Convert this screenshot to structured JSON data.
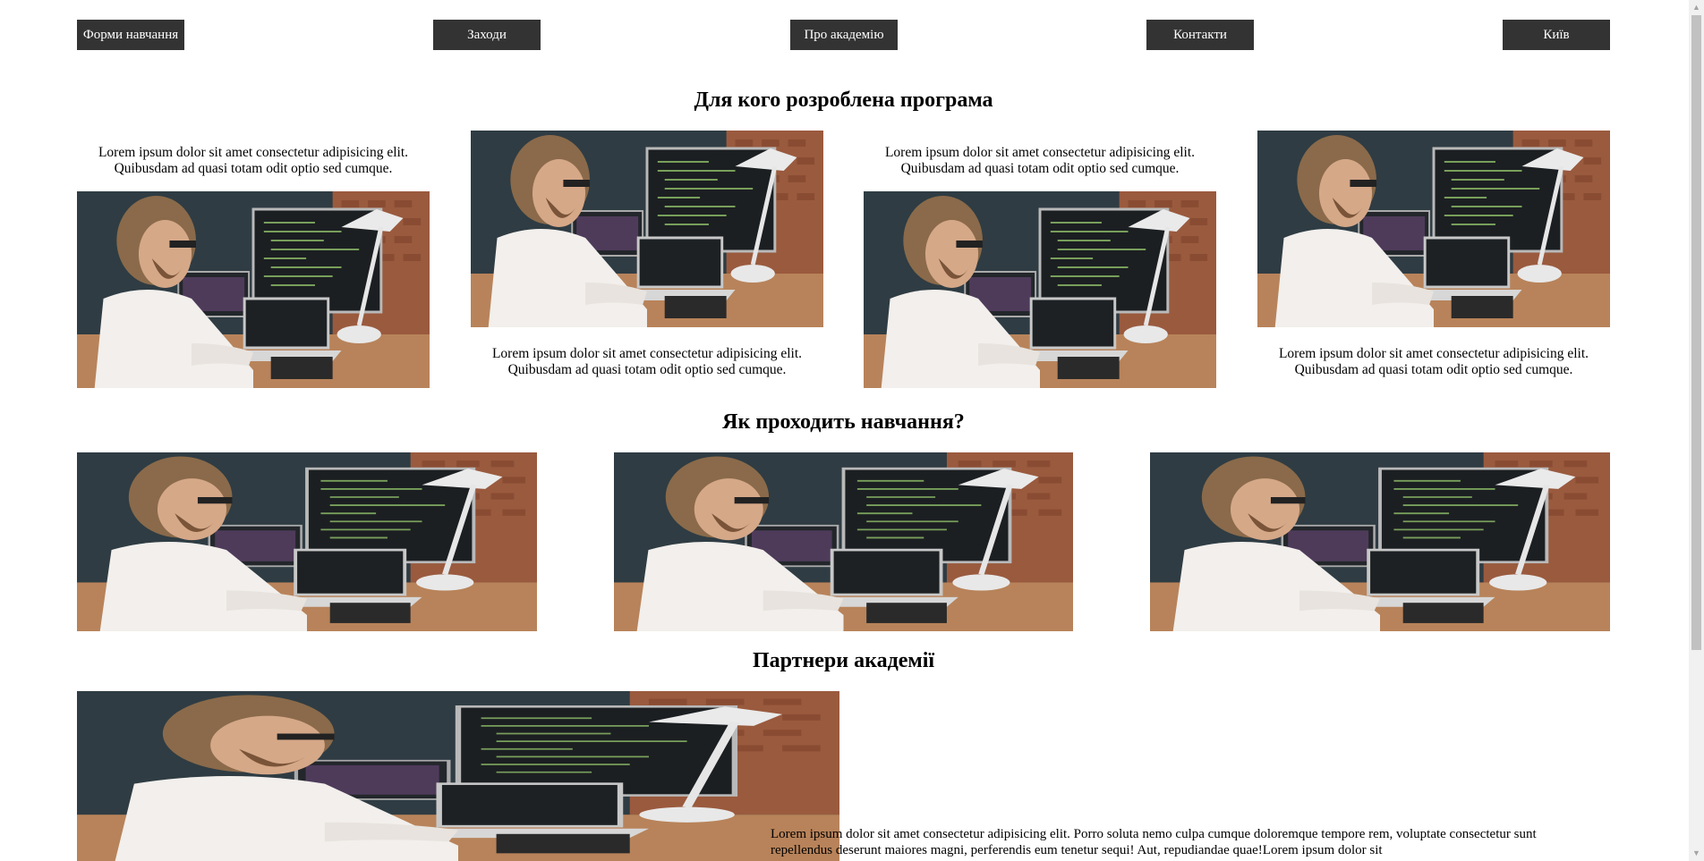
{
  "nav": {
    "items": [
      {
        "label": "Форми навчання"
      },
      {
        "label": "Заходи"
      },
      {
        "label": "Про академію"
      },
      {
        "label": "Контакти"
      },
      {
        "label": "Київ"
      }
    ]
  },
  "section_audience": {
    "title": "Для кого розроблена програма",
    "caption": "Lorem ipsum dolor sit amet consectetur adipisicing elit. Quibusdam ad quasi totam odit optio sed cumque."
  },
  "section_learning": {
    "title": "Як проходить навчання?"
  },
  "section_partners": {
    "title": "Партнери академії",
    "text": "Lorem ipsum dolor sit amet consectetur adipisicing elit. Porro soluta nemo culpa cumque doloremque tempore rem, voluptate consectetur sunt repellendus deserunt maiores magni, perferendis eum tenetur sequi! Aut, repudiandae quae!Lorem ipsum dolor sit"
  },
  "colors": {
    "nav_bg": "#333333",
    "nav_text": "#ffffff",
    "page_bg": "#ffffff"
  },
  "icons": {
    "scroll_up": "scroll-up-arrow-icon",
    "scroll_down": "scroll-down-arrow-icon"
  }
}
